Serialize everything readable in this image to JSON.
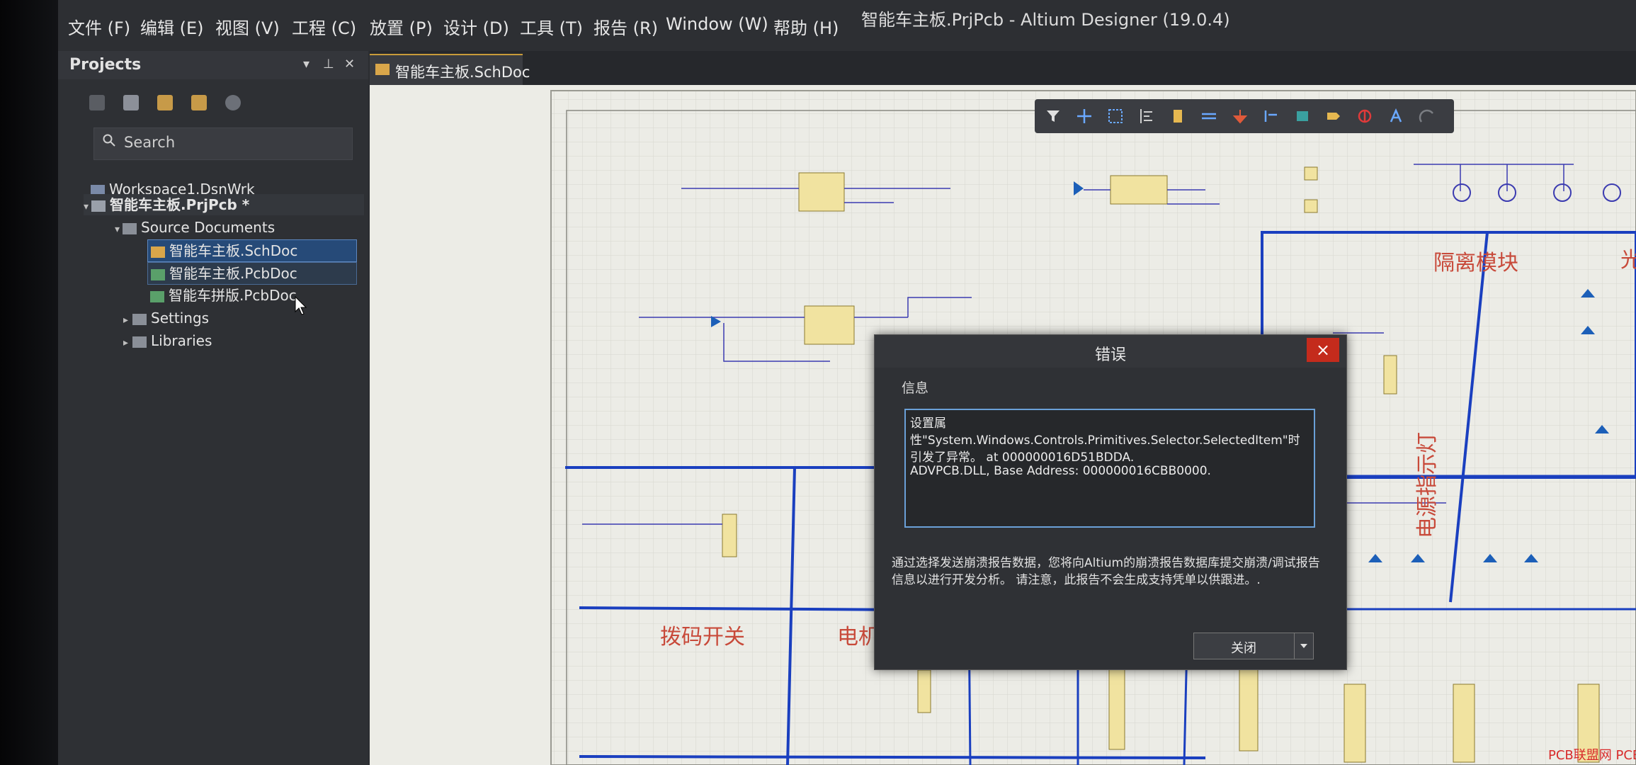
{
  "window": {
    "title": "智能车主板.PrjPcb - Altium Designer (19.0.4)"
  },
  "menubar": {
    "items": [
      "文件 (F)",
      "编辑 (E)",
      "视图 (V)",
      "工程 (C)",
      "放置 (P)",
      "设计 (D)",
      "工具 (T)",
      "报告 (R)",
      "Window (W)",
      "帮助 (H)"
    ]
  },
  "projects_panel": {
    "title": "Projects",
    "search_placeholder": "Search",
    "tree": {
      "workspace": "Workspace1.DsnWrk",
      "project": "智能车主板.PrjPcb *",
      "source_documents": "Source Documents",
      "docs": [
        "智能车主板.SchDoc",
        "智能车主板.PcbDoc",
        "智能车拼版.PcbDoc"
      ],
      "settings": "Settings",
      "libraries": "Libraries"
    }
  },
  "document_tab": {
    "label": "智能车主板.SchDoc"
  },
  "schematic": {
    "regions": [
      "隔离模块",
      "电源指示灯",
      "拨码开关",
      "电机",
      "光"
    ]
  },
  "error_dialog": {
    "title": "错误",
    "close_symbol": "×",
    "info_label": "信息",
    "message_lines": [
      "设置属",
      "性\"System.Windows.Controls.Primitives.Selector.SelectedItem\"时",
      "引发了异常。 at 000000016D51BDDA.",
      "ADVPCB.DLL, Base Address: 000000016CBB0000."
    ],
    "note": "通过选择发送崩溃报告数据，您将向Altium的崩溃报告数据库提交崩溃/调试报告信息以进行开发分析。 请注意，此报告不会生成支持凭单以供跟进。.",
    "button_label": "关闭"
  },
  "watermark": "PCB联盟网 PCBbar.com",
  "colors": {
    "accent": "#c84a3a",
    "selection": "#264a78",
    "dialog_border": "#6aa0d8",
    "close_red": "#c42b1c"
  }
}
